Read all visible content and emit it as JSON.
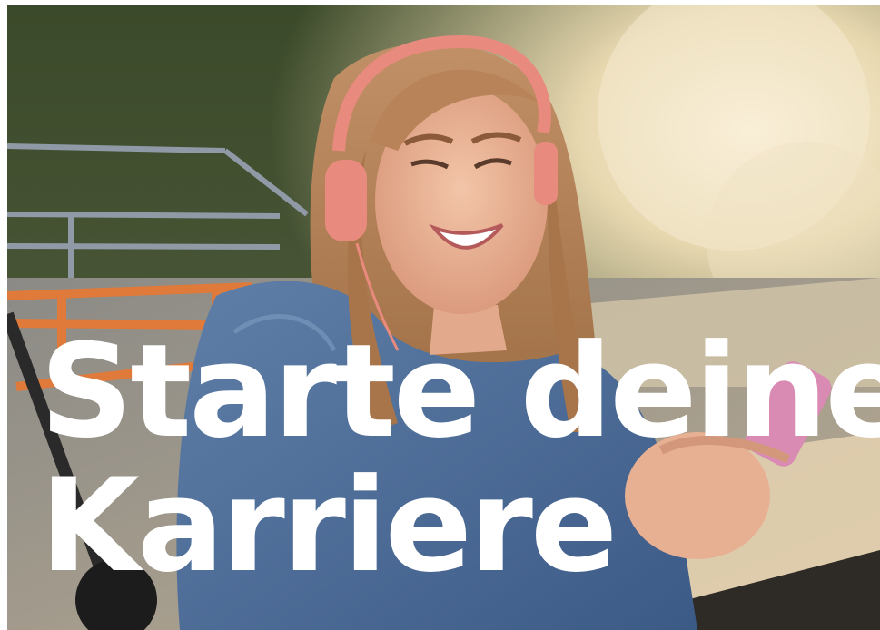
{
  "headline": {
    "line1": "Starte deine",
    "line2": "Karriere"
  },
  "colors": {
    "headline_text": "#ffffff",
    "headphones": "#e98a7e",
    "jacket": "#4f6f9c",
    "phone": "#d98bb4",
    "railing": "#e07a3a"
  },
  "icons": {
    "photo": "young-woman-with-headphones-and-smartphone-at-skatepark"
  }
}
